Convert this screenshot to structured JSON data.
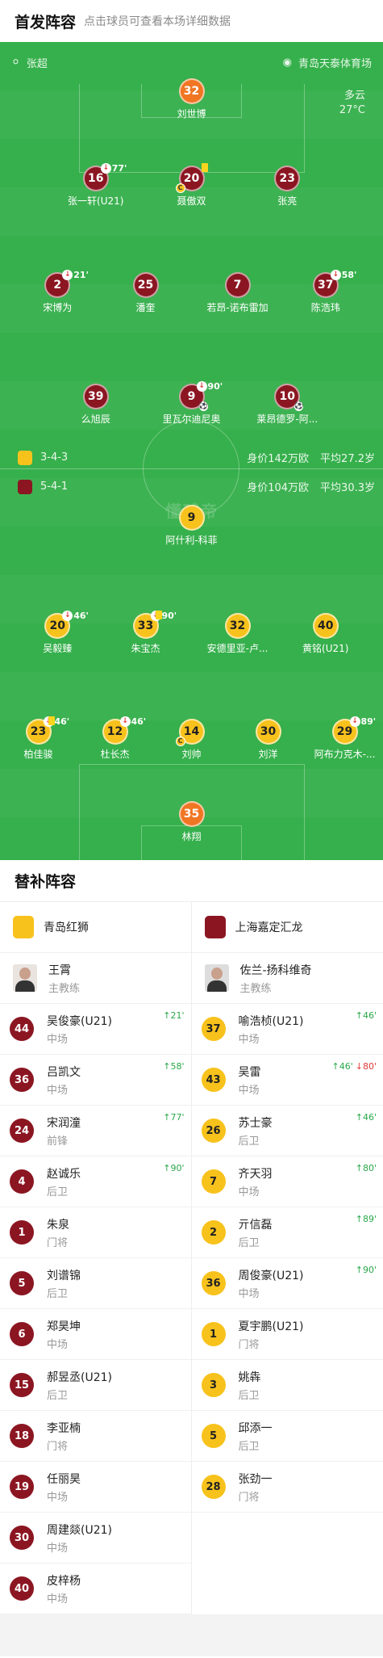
{
  "header": {
    "title": "首发阵容",
    "subtitle": "点击球员可查看本场详细数据"
  },
  "pitch": {
    "referee": "张超",
    "venue": "青岛天泰体育场",
    "weather": "多云",
    "temperature": "27°C",
    "watermark": "懂球帝"
  },
  "home_team": {
    "formation": "3-4-3",
    "value": "身价142万欧",
    "avg_age": "平均27.2岁",
    "color": "#8b1622"
  },
  "away_team": {
    "formation": "5-4-1",
    "value": "身价104万欧",
    "avg_age": "平均30.3岁",
    "color": "#f8c21c"
  },
  "home_players": [
    {
      "num": "32",
      "name": "刘世博",
      "row": 0,
      "col": 0.5,
      "gk": true
    },
    {
      "num": "16",
      "name": "张一轩(U21)",
      "row": 1,
      "col": 0.25,
      "sub": "77'"
    },
    {
      "num": "20",
      "name": "聂傲双",
      "row": 1,
      "col": 0.5,
      "yellow": true,
      "captain": true
    },
    {
      "num": "23",
      "name": "张亮",
      "row": 1,
      "col": 0.75
    },
    {
      "num": "2",
      "name": "宋博为",
      "row": 2,
      "col": 0.15,
      "sub": "21'"
    },
    {
      "num": "25",
      "name": "潘奎",
      "row": 2,
      "col": 0.38
    },
    {
      "num": "7",
      "name": "若昂-诺布雷加",
      "row": 2,
      "col": 0.62
    },
    {
      "num": "37",
      "name": "陈浩玮",
      "row": 2,
      "col": 0.85,
      "sub": "58'"
    },
    {
      "num": "39",
      "name": "么旭辰",
      "row": 3,
      "col": 0.25
    },
    {
      "num": "9",
      "name": "里瓦尔迪尼奥",
      "row": 3,
      "col": 0.5,
      "sub": "90'",
      "goal": true
    },
    {
      "num": "10",
      "name": "莱昂德罗-阿...",
      "row": 3,
      "col": 0.75,
      "ball": true
    }
  ],
  "away_players": [
    {
      "num": "9",
      "name": "阿什利-科菲",
      "row": 0,
      "col": 0.5
    },
    {
      "num": "20",
      "name": "吴毅臻",
      "row": 1,
      "col": 0.15,
      "sub": "46'"
    },
    {
      "num": "33",
      "name": "朱宝杰",
      "row": 1,
      "col": 0.38,
      "sub": "90'",
      "yellow": true
    },
    {
      "num": "32",
      "name": "安德里亚-卢...",
      "row": 1,
      "col": 0.62
    },
    {
      "num": "40",
      "name": "黄铭(U21)",
      "row": 1,
      "col": 0.85
    },
    {
      "num": "23",
      "name": "柏佳骏",
      "row": 2,
      "col": 0.1,
      "sub": "46'",
      "yellow": true
    },
    {
      "num": "12",
      "name": "杜长杰",
      "row": 2,
      "col": 0.3,
      "sub": "46'"
    },
    {
      "num": "14",
      "name": "刘帅",
      "row": 2,
      "col": 0.5,
      "captain": true
    },
    {
      "num": "30",
      "name": "刘洋",
      "row": 2,
      "col": 0.7
    },
    {
      "num": "29",
      "name": "阿布力克木-...",
      "row": 2,
      "col": 0.9,
      "sub": "89'"
    },
    {
      "num": "35",
      "name": "林翔",
      "row": 3,
      "col": 0.5,
      "gk": true
    }
  ],
  "subs_title": "替补阵容",
  "left": {
    "team": "青岛红狮",
    "coach": "王霄",
    "coach_role": "主教练",
    "color": "#8b1622",
    "players": [
      {
        "num": "44",
        "name": "吴俊豪(U21)",
        "pos": "中场",
        "in": "21'"
      },
      {
        "num": "36",
        "name": "吕凯文",
        "pos": "中场",
        "in": "58'"
      },
      {
        "num": "24",
        "name": "宋润潼",
        "pos": "前锋",
        "in": "77'"
      },
      {
        "num": "4",
        "name": "赵诚乐",
        "pos": "后卫",
        "in": "90'"
      },
      {
        "num": "1",
        "name": "朱泉",
        "pos": "门将"
      },
      {
        "num": "5",
        "name": "刘谱锦",
        "pos": "后卫"
      },
      {
        "num": "6",
        "name": "郑昊坤",
        "pos": "中场"
      },
      {
        "num": "15",
        "name": "郝昱丞(U21)",
        "pos": "后卫"
      },
      {
        "num": "18",
        "name": "李亚楠",
        "pos": "门将"
      },
      {
        "num": "19",
        "name": "任丽昊",
        "pos": "中场"
      },
      {
        "num": "30",
        "name": "周建燚(U21)",
        "pos": "中场"
      },
      {
        "num": "40",
        "name": "皮梓杨",
        "pos": "中场"
      }
    ]
  },
  "right": {
    "team": "上海嘉定汇龙",
    "coach": "佐兰-扬科维奇",
    "coach_role": "主教练",
    "color": "#f8c21c",
    "players": [
      {
        "num": "37",
        "name": "喻浩桢(U21)",
        "pos": "中场",
        "in": "46'"
      },
      {
        "num": "43",
        "name": "吴雷",
        "pos": "中场",
        "in": "46'",
        "out": "80'"
      },
      {
        "num": "26",
        "name": "苏士豪",
        "pos": "后卫",
        "in": "46'"
      },
      {
        "num": "7",
        "name": "齐天羽",
        "pos": "中场",
        "in": "80'"
      },
      {
        "num": "2",
        "name": "亓信磊",
        "pos": "后卫",
        "in": "89'"
      },
      {
        "num": "36",
        "name": "周俊豪(U21)",
        "pos": "中场",
        "in": "90'"
      },
      {
        "num": "1",
        "name": "夏宇鹏(U21)",
        "pos": "门将"
      },
      {
        "num": "3",
        "name": "姚犇",
        "pos": "后卫"
      },
      {
        "num": "5",
        "name": "邱添一",
        "pos": "后卫"
      },
      {
        "num": "28",
        "name": "张劲一",
        "pos": "门将"
      }
    ]
  }
}
